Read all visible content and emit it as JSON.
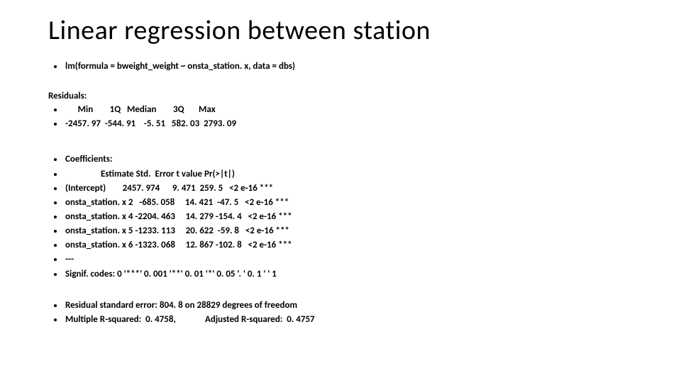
{
  "title": "Linear regression between station",
  "formula_line": "lm(formula = bweight_weight ~ onsta_station. x, data = dbs)",
  "residuals": {
    "label": "Residuals:",
    "header": "      Min        1Q   Median        3Q       Max",
    "values": "-2457. 97  -544. 91    -5. 51   582. 03  2793. 09"
  },
  "coefficients": {
    "label": "Coefficients:",
    "header": "                 Estimate Std.  Error t value Pr(>|t|)",
    "rows": [
      "(Intercept)        2457. 974      9. 471  259. 5   <2 e-16 ***",
      "onsta_station. x 2   -685. 058     14. 421  -47. 5   <2 e-16 ***",
      "onsta_station. x 4 -2204. 463     14. 279 -154. 4   <2 e-16 ***",
      "onsta_station. x 5 -1233. 113     20. 622  -59. 8   <2 e-16 ***",
      "onsta_station. x 6 -1323. 068     12. 867 -102. 8   <2 e-16 ***"
    ],
    "sep": "---",
    "signif": "Signif. codes:  0 '***' 0. 001 '**' 0. 01 '*' 0. 05 '. ' 0. 1 ' ' 1"
  },
  "footer": {
    "rse": "Residual standard error: 804. 8 on 28829 degrees of freedom",
    "r2": "Multiple R-squared:  0. 4758,              Adjusted R-squared:  0. 4757"
  }
}
